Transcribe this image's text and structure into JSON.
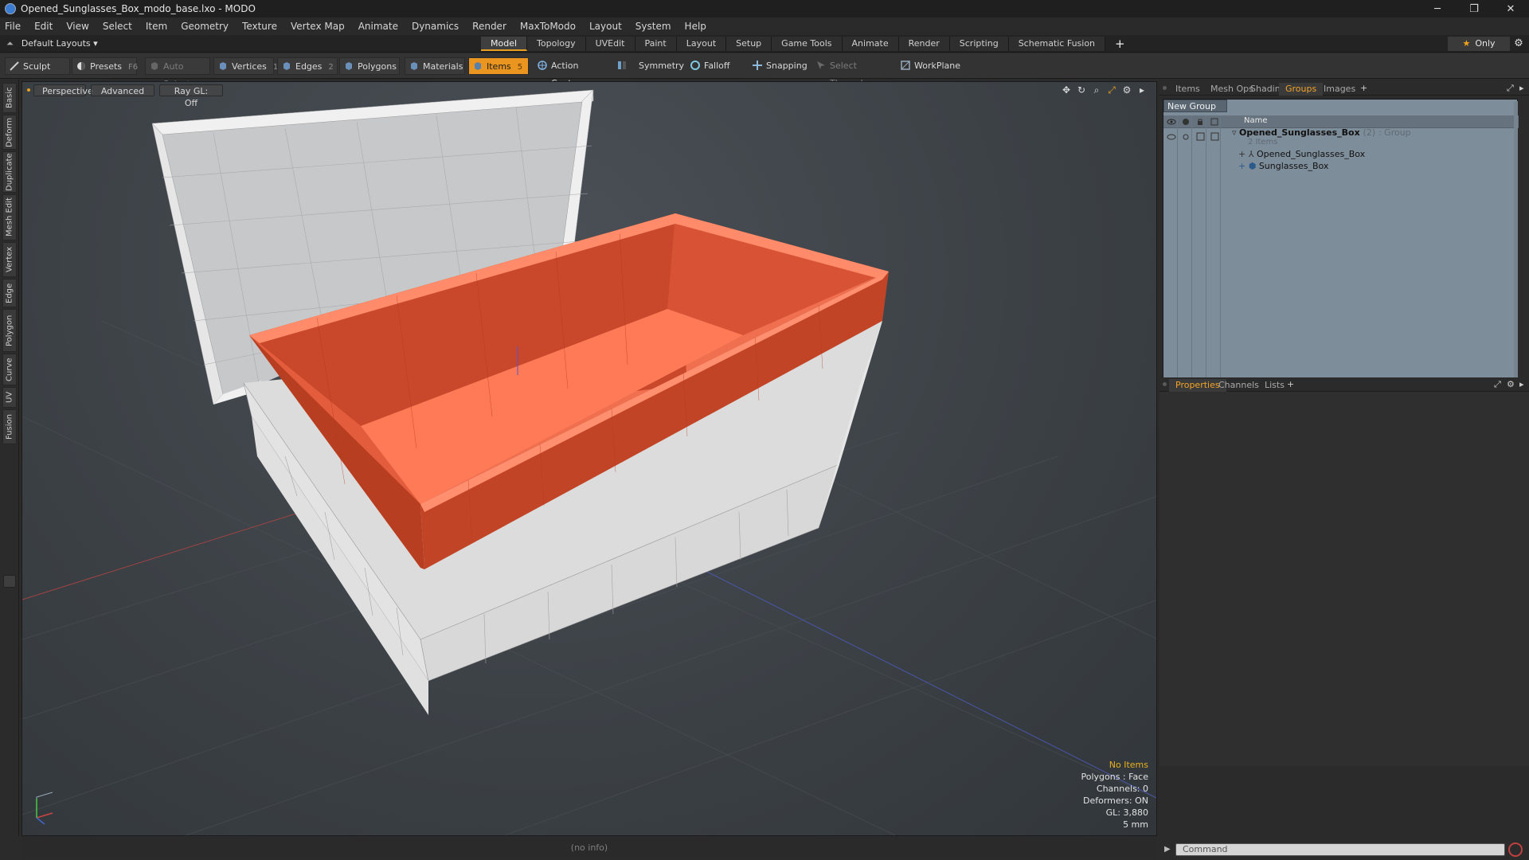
{
  "window": {
    "title": "Opened_Sunglasses_Box_modo_base.lxo - MODO",
    "minimize_glyph": "─",
    "restore_glyph": "❐",
    "close_glyph": "✕"
  },
  "menu": [
    "File",
    "Edit",
    "View",
    "Select",
    "Item",
    "Geometry",
    "Texture",
    "Vertex Map",
    "Animate",
    "Dynamics",
    "Render",
    "MaxToModo",
    "Layout",
    "System",
    "Help"
  ],
  "layout": {
    "dropdown": "Default Layouts ▾",
    "tabs": [
      "Model",
      "Topology",
      "UVEdit",
      "Paint",
      "Layout",
      "Setup",
      "Game Tools",
      "Animate",
      "Render",
      "Scripting",
      "Schematic Fusion"
    ],
    "active_tab": "Model",
    "plus": "+",
    "only_label": "Only",
    "gear_glyph": "⚙"
  },
  "toolbar": {
    "sculpt": "Sculpt",
    "presets": "Presets",
    "presets_key": "F6",
    "auto_select": "Auto Select",
    "vertices": "Vertices",
    "vertices_key": "1",
    "edges": "Edges",
    "edges_key": "2",
    "polygons": "Polygons",
    "materials": "Materials",
    "items": "Items",
    "items_key": "5",
    "action_center": "Action Center",
    "symmetry": "Symmetry",
    "falloff": "Falloff",
    "snapping": "Snapping",
    "select_through": "Select Through",
    "workplane": "WorkPlane"
  },
  "left_tabs": [
    "Basic",
    "Deform",
    "Duplicate",
    "Mesh Edit",
    "Vertex",
    "Edge",
    "Polygon",
    "Curve",
    "UV",
    "Fusion"
  ],
  "viewport": {
    "view": "Perspective",
    "mode": "Advanced",
    "raygl": "Ray GL: Off",
    "icons": [
      "move-icon",
      "rotate-icon",
      "zoom-icon",
      "maximize-icon",
      "settings-icon",
      "arrow-icon"
    ],
    "stats": {
      "items": "No Items",
      "polygons": "Polygons : Face",
      "channels": "Channels: 0",
      "deformers": "Deformers: ON",
      "gl": "GL: 3,880",
      "unit": "5 mm"
    },
    "colors": {
      "box_orange": "#e4603f",
      "box_white": "#e2e2e2",
      "accent": "#e8a020"
    }
  },
  "status": {
    "info": "(no info)"
  },
  "right_top_tabs": [
    "Items",
    "Mesh Ops",
    "Shading",
    "Groups",
    "Images"
  ],
  "right_top_active": "Groups",
  "groups": {
    "new_group": "New Group",
    "col_name": "Name",
    "root_name": "Opened_Sunglasses_Box",
    "root_count": "(2)",
    "root_type": ": Group",
    "root_sub": "2 Items",
    "children": [
      "Opened_Sunglasses_Box",
      "Sunglasses_Box"
    ]
  },
  "right_bottom_tabs": [
    "Properties",
    "Channels",
    "Lists"
  ],
  "right_bottom_active": "Properties",
  "command": {
    "placeholder": "Command"
  }
}
